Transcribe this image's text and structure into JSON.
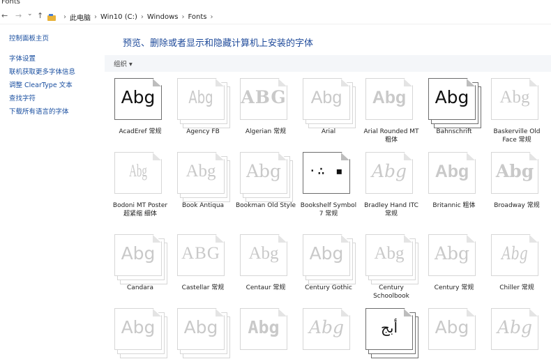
{
  "window": {
    "title": "Fonts"
  },
  "address": {
    "crumbs": [
      "此电脑",
      "Win10 (C:)",
      "Windows",
      "Fonts"
    ],
    "back": "←",
    "forward": "→",
    "recent": "⌄",
    "up": "↑"
  },
  "sidebar": {
    "home_link": "控制面板主页",
    "links": [
      "字体设置",
      "联机获取更多字体信息",
      "调整 ClearType 文本",
      "查找字符",
      "下载所有语言的字体"
    ]
  },
  "main": {
    "title": "预览、删除或者显示和隐藏计算机上安装的字体"
  },
  "toolbar": {
    "organize": "组织 ▾"
  },
  "fonts": [
    {
      "name": "AcadEref 常规",
      "sample": "Abg",
      "selected": true,
      "stack": false
    },
    {
      "name": "Agency FB",
      "sample": "Abg",
      "selected": false,
      "stack": true
    },
    {
      "name": "Algerian 常规",
      "sample": "ABG",
      "selected": false,
      "stack": false
    },
    {
      "name": "Arial",
      "sample": "Abg",
      "selected": false,
      "stack": true
    },
    {
      "name": "Arial Rounded MT 粗体",
      "sample": "Abg",
      "selected": false,
      "stack": false
    },
    {
      "name": "Bahnschrift",
      "sample": "Abg",
      "selected": true,
      "stack": true
    },
    {
      "name": "Baskerville Old Face 常规",
      "sample": "Abg",
      "selected": false,
      "stack": false
    },
    {
      "name": "Bodoni MT Poster 超紧缩 细体",
      "sample": "Abg",
      "selected": false,
      "stack": false
    },
    {
      "name": "Book Antiqua",
      "sample": "Abg",
      "selected": false,
      "stack": true
    },
    {
      "name": "Bookman Old Style",
      "sample": "Abg",
      "selected": false,
      "stack": true
    },
    {
      "name": "Bookshelf Symbol 7 常规",
      "sample": "·∴ ▪",
      "selected": true,
      "stack": false
    },
    {
      "name": "Bradley Hand ITC 常规",
      "sample": "Abg",
      "selected": false,
      "stack": false
    },
    {
      "name": "Britannic 粗体",
      "sample": "Abg",
      "selected": false,
      "stack": false
    },
    {
      "name": "Broadway 常规",
      "sample": "Abg",
      "selected": false,
      "stack": false
    },
    {
      "name": "Candara",
      "sample": "Abg",
      "selected": false,
      "stack": true
    },
    {
      "name": "Castellar 常规",
      "sample": "ABG",
      "selected": false,
      "stack": false
    },
    {
      "name": "Centaur 常规",
      "sample": "Abg",
      "selected": false,
      "stack": false
    },
    {
      "name": "Century Gothic",
      "sample": "Abg",
      "selected": false,
      "stack": true
    },
    {
      "name": "Century Schoolbook",
      "sample": "Abg",
      "selected": false,
      "stack": true
    },
    {
      "name": "Century 常规",
      "sample": "Abg",
      "selected": false,
      "stack": false
    },
    {
      "name": "Chiller 常规",
      "sample": "Abg",
      "selected": false,
      "stack": false
    },
    {
      "name": "",
      "sample": "Abg",
      "selected": false,
      "stack": true
    },
    {
      "name": "",
      "sample": "Abg",
      "selected": false,
      "stack": true
    },
    {
      "name": "",
      "sample": "Abg",
      "selected": false,
      "stack": false
    },
    {
      "name": "",
      "sample": "Abg",
      "selected": false,
      "stack": false
    },
    {
      "name": "",
      "sample": "أبج",
      "selected": true,
      "stack": true
    },
    {
      "name": "",
      "sample": "Abg",
      "selected": false,
      "stack": false
    },
    {
      "name": "",
      "sample": "Abg",
      "selected": false,
      "stack": false
    }
  ]
}
